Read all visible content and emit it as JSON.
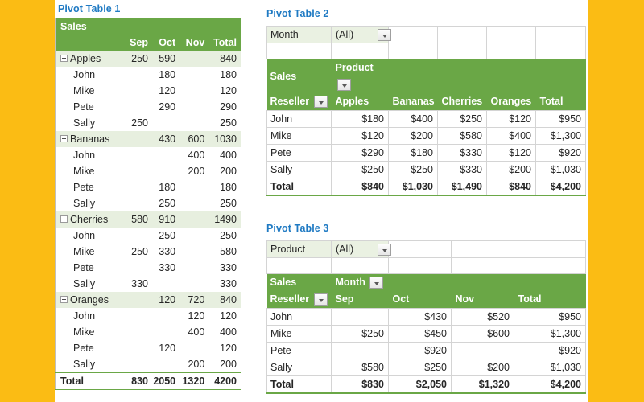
{
  "colors": {
    "page_background": "#FBBC14",
    "canvas": "#FFFFFF",
    "title_blue": "#1F7AC3",
    "header_green": "#6AA746",
    "group_row_green": "#E7EFDF",
    "filter_cell_green": "#EAF1E2",
    "grid_line": "#D4D4D4"
  },
  "pivot1": {
    "title": "Pivot Table 1",
    "corner_label": "Sales",
    "columns": [
      "Sep",
      "Oct",
      "Nov",
      "Total"
    ],
    "rows": [
      {
        "type": "group",
        "label": "Apples",
        "collapse_icon": "minus-icon",
        "values": [
          "250",
          "590",
          "",
          "840"
        ]
      },
      {
        "type": "item",
        "label": "John",
        "values": [
          "",
          "180",
          "",
          "180"
        ]
      },
      {
        "type": "item",
        "label": "Mike",
        "values": [
          "",
          "120",
          "",
          "120"
        ]
      },
      {
        "type": "item",
        "label": "Pete",
        "values": [
          "",
          "290",
          "",
          "290"
        ]
      },
      {
        "type": "item",
        "label": "Sally",
        "values": [
          "250",
          "",
          "",
          "250"
        ]
      },
      {
        "type": "group",
        "label": "Bananas",
        "collapse_icon": "minus-icon",
        "values": [
          "",
          "430",
          "600",
          "1030"
        ]
      },
      {
        "type": "item",
        "label": "John",
        "values": [
          "",
          "",
          "400",
          "400"
        ]
      },
      {
        "type": "item",
        "label": "Mike",
        "values": [
          "",
          "",
          "200",
          "200"
        ]
      },
      {
        "type": "item",
        "label": "Pete",
        "values": [
          "",
          "180",
          "",
          "180"
        ]
      },
      {
        "type": "item",
        "label": "Sally",
        "values": [
          "",
          "250",
          "",
          "250"
        ]
      },
      {
        "type": "group",
        "label": "Cherries",
        "collapse_icon": "minus-icon",
        "values": [
          "580",
          "910",
          "",
          "1490"
        ]
      },
      {
        "type": "item",
        "label": "John",
        "values": [
          "",
          "250",
          "",
          "250"
        ]
      },
      {
        "type": "item",
        "label": "Mike",
        "values": [
          "250",
          "330",
          "",
          "580"
        ]
      },
      {
        "type": "item",
        "label": "Pete",
        "values": [
          "",
          "330",
          "",
          "330"
        ]
      },
      {
        "type": "item",
        "label": "Sally",
        "values": [
          "330",
          "",
          "",
          "330"
        ]
      },
      {
        "type": "group",
        "label": "Oranges",
        "collapse_icon": "minus-icon",
        "values": [
          "",
          "120",
          "720",
          "840"
        ]
      },
      {
        "type": "item",
        "label": "John",
        "values": [
          "",
          "",
          "120",
          "120"
        ]
      },
      {
        "type": "item",
        "label": "Mike",
        "values": [
          "",
          "",
          "400",
          "400"
        ]
      },
      {
        "type": "item",
        "label": "Pete",
        "values": [
          "",
          "120",
          "",
          "120"
        ]
      },
      {
        "type": "item",
        "label": "Sally",
        "values": [
          "",
          "",
          "200",
          "200"
        ]
      }
    ],
    "total_row": {
      "label": "Total",
      "values": [
        "830",
        "2050",
        "1320",
        "4200"
      ]
    }
  },
  "pivot2": {
    "title": "Pivot Table 2",
    "filter": {
      "field_label": "Month",
      "value": "(All)",
      "dropdown_icon": "chevron-down-icon"
    },
    "corner_label": "Sales",
    "column_field_label": "Product",
    "column_field_dropdown_icon": "chevron-down-icon",
    "row_field_label": "Reseller",
    "row_field_dropdown_icon": "chevron-down-icon",
    "columns": [
      "Apples",
      "Bananas",
      "Cherries",
      "Oranges",
      "Total"
    ],
    "rows": [
      {
        "label": "John",
        "values": [
          "$180",
          "$400",
          "$250",
          "$120",
          "$950"
        ]
      },
      {
        "label": "Mike",
        "values": [
          "$120",
          "$200",
          "$580",
          "$400",
          "$1,300"
        ]
      },
      {
        "label": "Pete",
        "values": [
          "$290",
          "$180",
          "$330",
          "$120",
          "$920"
        ]
      },
      {
        "label": "Sally",
        "values": [
          "$250",
          "$250",
          "$330",
          "$200",
          "$1,030"
        ]
      }
    ],
    "total_row": {
      "label": "Total",
      "values": [
        "$840",
        "$1,030",
        "$1,490",
        "$840",
        "$4,200"
      ]
    }
  },
  "pivot3": {
    "title": "Pivot Table 3",
    "filter": {
      "field_label": "Product",
      "value": "(All)",
      "dropdown_icon": "chevron-down-icon"
    },
    "corner_label": "Sales",
    "column_field_label": "Month",
    "column_field_dropdown_icon": "chevron-down-icon",
    "row_field_label": "Reseller",
    "row_field_dropdown_icon": "chevron-down-icon",
    "columns": [
      "Sep",
      "Oct",
      "Nov",
      "Total"
    ],
    "rows": [
      {
        "label": "John",
        "values": [
          "",
          "$430",
          "$520",
          "$950"
        ]
      },
      {
        "label": "Mike",
        "values": [
          "$250",
          "$450",
          "$600",
          "$1,300"
        ]
      },
      {
        "label": "Pete",
        "values": [
          "",
          "$920",
          "",
          "$920"
        ]
      },
      {
        "label": "Sally",
        "values": [
          "$580",
          "$250",
          "$200",
          "$1,030"
        ]
      }
    ],
    "total_row": {
      "label": "Total",
      "values": [
        "$830",
        "$2,050",
        "$1,320",
        "$4,200"
      ]
    }
  }
}
